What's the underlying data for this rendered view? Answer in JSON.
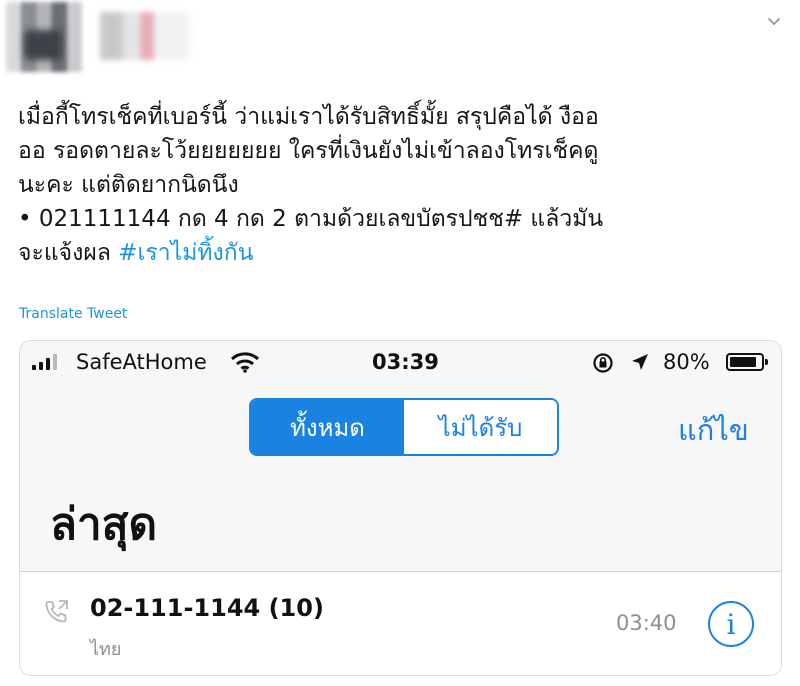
{
  "tweet": {
    "lines": [
      "เมื่อกี้โทรเช็คที่เบอร์นี้ ว่าแม่เราได้รับสิทธิ์มั้ย สรุปคือได้ งืออ",
      "ออ รอดตายละโว้ยยยยยยย ใครที่เงินยังไม่เข้าลองโทรเช็คดู",
      "นะคะ แต่ติดยากนิดนึง",
      "• 021111144 กด 4 กด 2 ตามด้วยเลขบัตรปชช# แล้วมัน"
    ],
    "last_line_prefix": "จะแจ้งผล ",
    "hashtag": "#เราไม่ทิ้งกัน",
    "translate_label": "Translate Tweet"
  },
  "phone_screenshot": {
    "status_bar": {
      "carrier": "SafeAtHome",
      "time": "03:39",
      "battery": "80%"
    },
    "segment": {
      "all_label": "ทั้งหมด",
      "missed_label": "ไม่ได้รับ"
    },
    "edit_label": "แก้ไข",
    "title": "ล่าสุด",
    "recents": [
      {
        "number": "02-111-1144 (10)",
        "location": "ไทย",
        "time": "03:40"
      }
    ]
  },
  "colors": {
    "hashtag": "#1b95e0",
    "ios_blue": "#1a82e0"
  },
  "icons": {
    "more": "chevron-down-icon",
    "info": "info-icon"
  }
}
